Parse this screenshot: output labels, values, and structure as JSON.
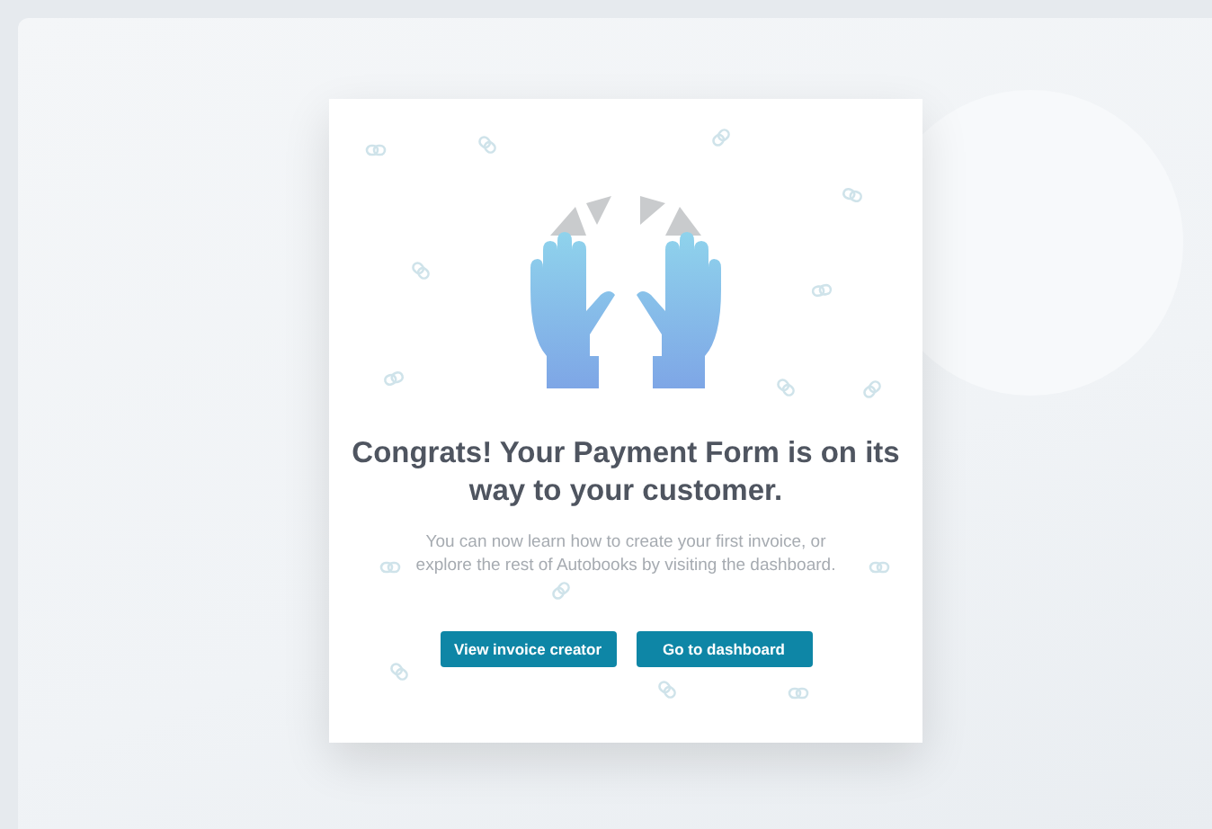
{
  "dialog": {
    "title": "Congrats! Your Payment Form is on its way to your customer.",
    "message": "You can now learn how to create your first invoice, or explore the rest of Autobooks by visiting the dashboard.",
    "buttons": [
      {
        "label": "View invoice creator"
      },
      {
        "label": "Go to dashboard"
      }
    ]
  }
}
